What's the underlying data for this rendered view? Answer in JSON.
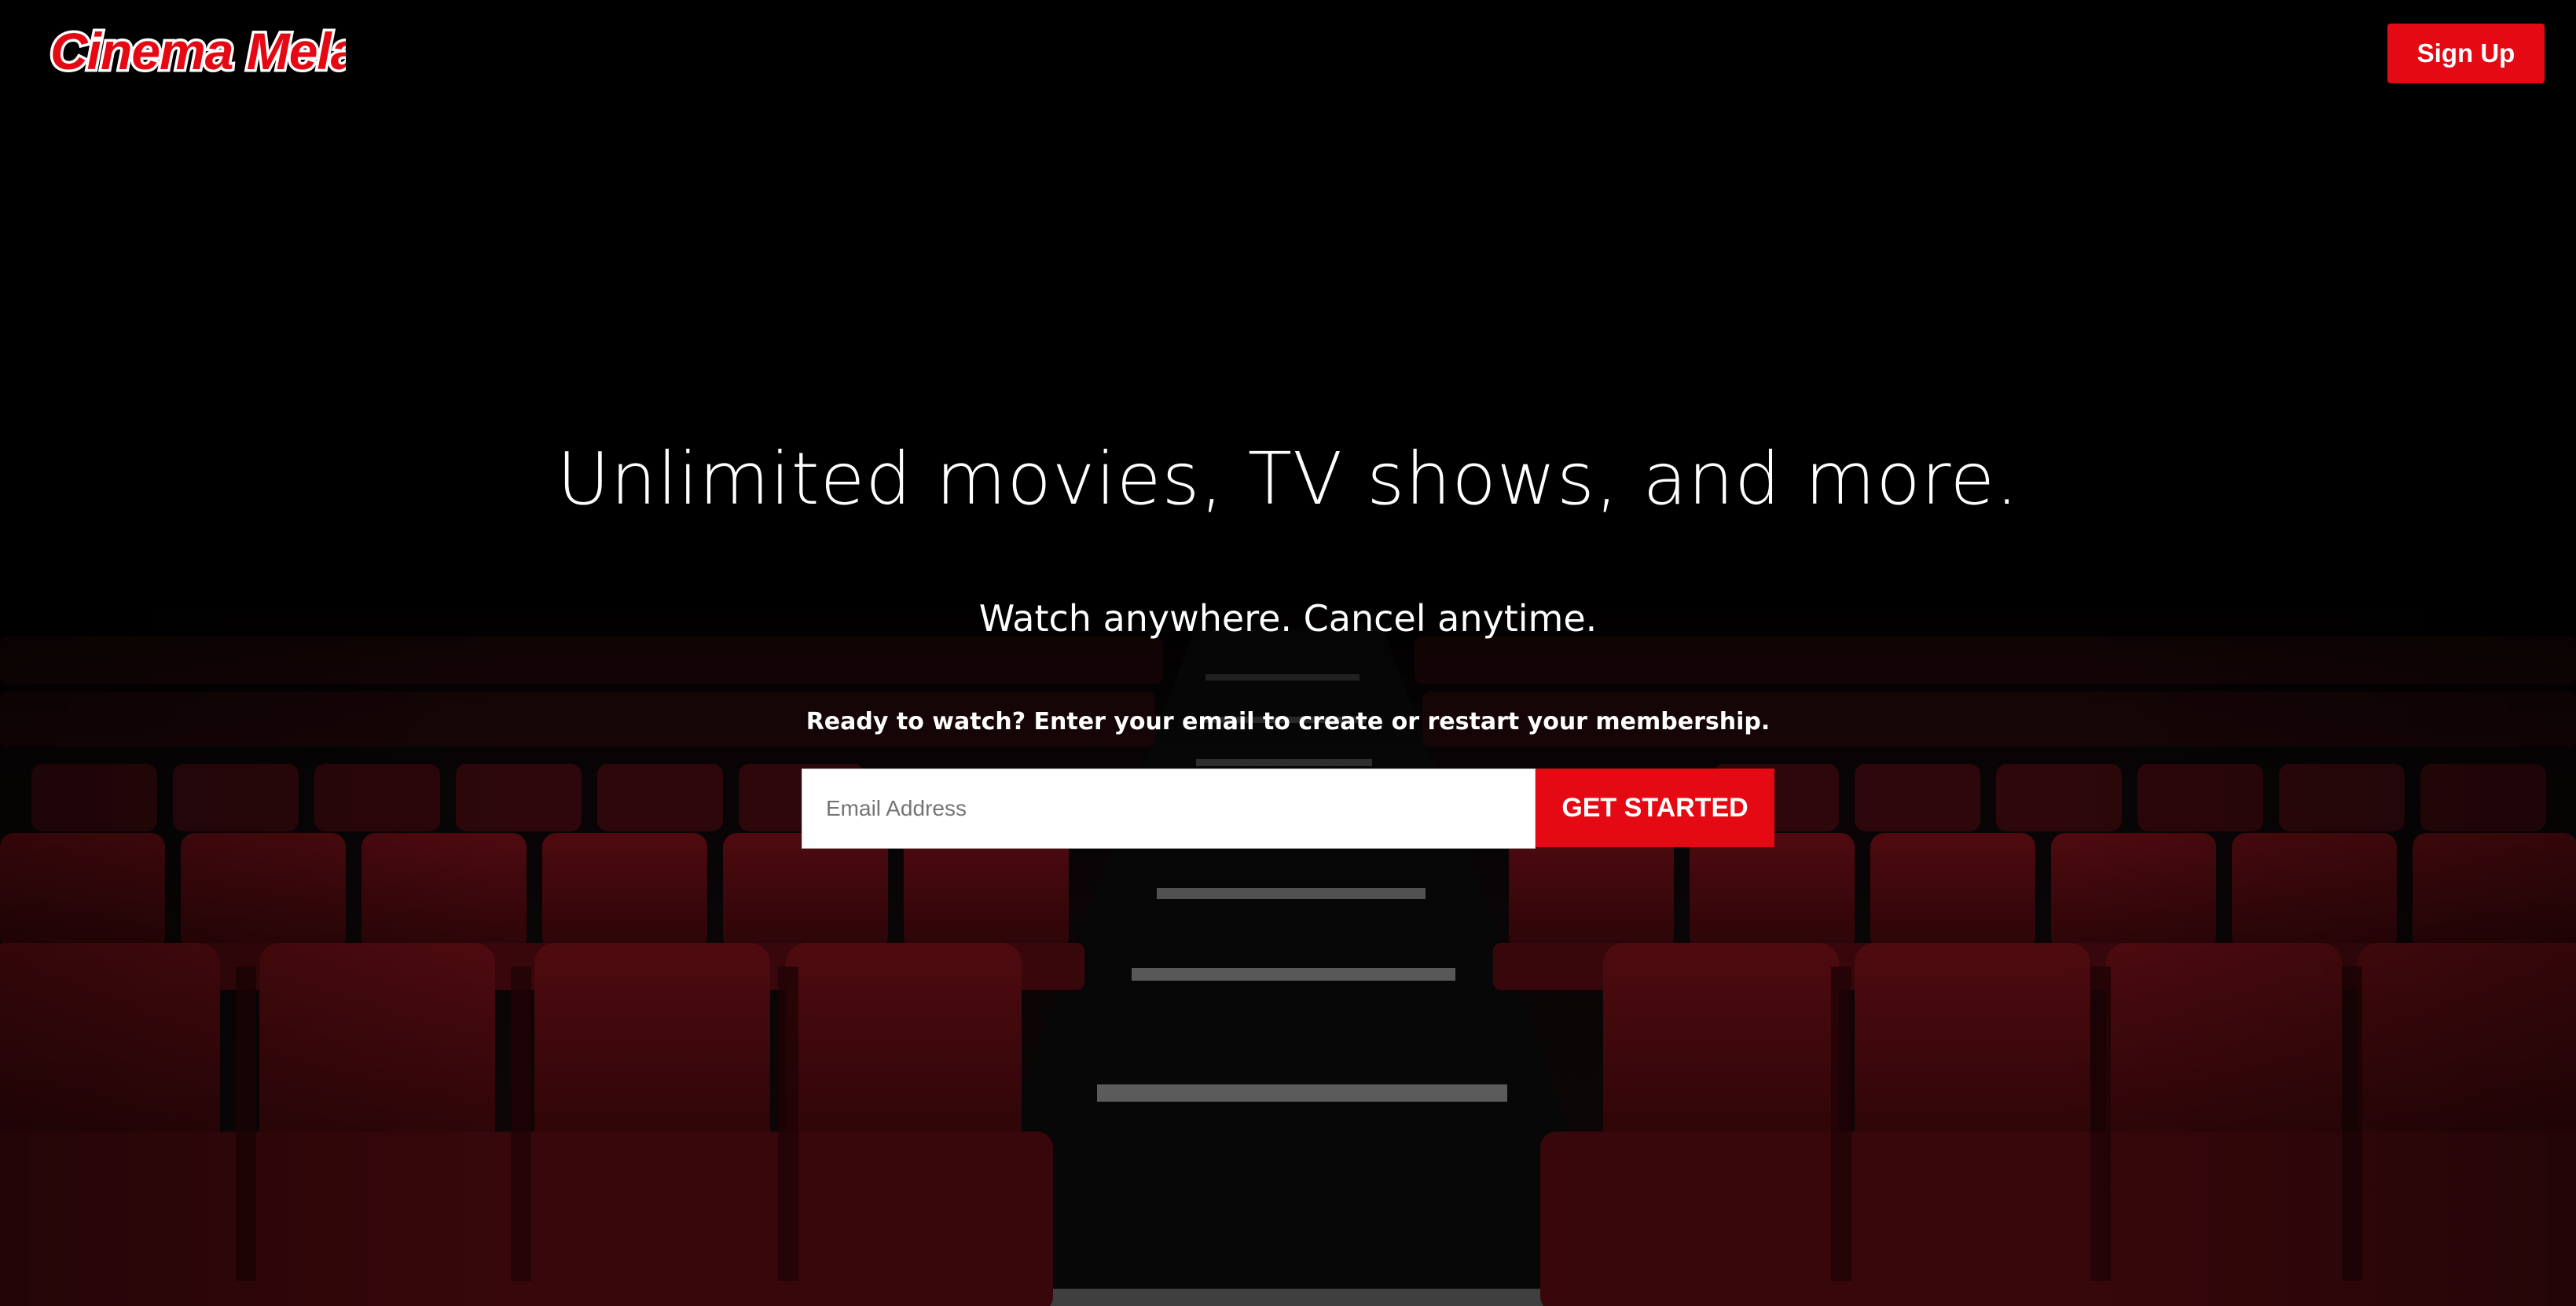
{
  "header": {
    "logo_text": "Cinema Mela",
    "signup_label": "Sign Up"
  },
  "hero": {
    "title": "Unlimited movies, TV shows, and more.",
    "subtitle": "Watch anywhere. Cancel anytime.",
    "cta_text": "Ready to watch? Enter your email to create or restart your membership.",
    "email_placeholder": "Email Address",
    "email_value": "",
    "get_started_label": "GET STARTED"
  },
  "colors": {
    "brand_red": "#e50914",
    "background": "#000000",
    "seat_red": "#5a0b10",
    "text": "#ffffff"
  }
}
